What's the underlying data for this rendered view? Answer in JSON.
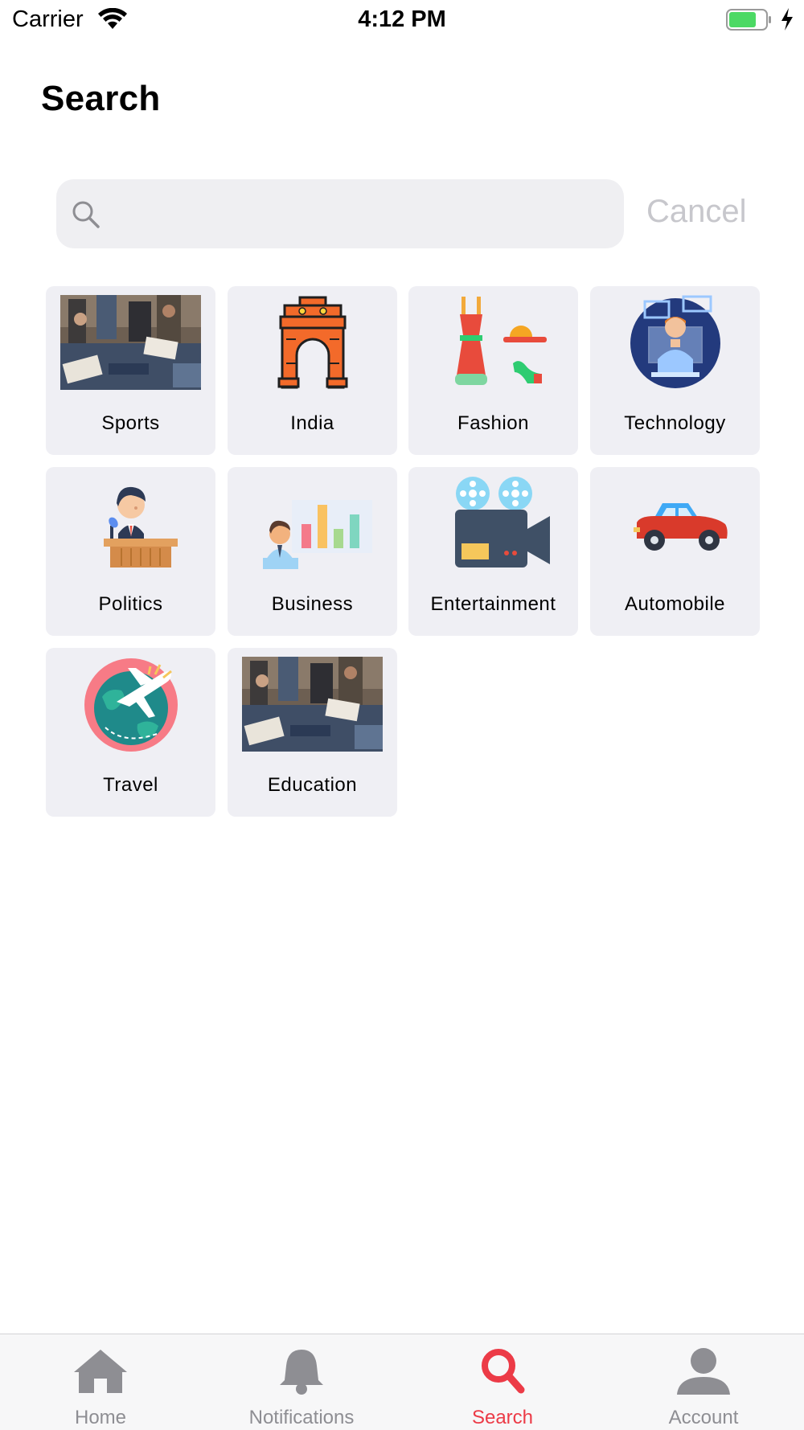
{
  "status_bar": {
    "carrier": "Carrier",
    "time": "4:12 PM",
    "battery_color": "#4cd964"
  },
  "header": {
    "title": "Search"
  },
  "search": {
    "value": "",
    "placeholder": "",
    "cancel_label": "Cancel"
  },
  "categories": [
    {
      "label": "Sports",
      "icon": "classroom-photo"
    },
    {
      "label": "India",
      "icon": "india-gate-icon"
    },
    {
      "label": "Fashion",
      "icon": "dress-hat-shoe-icon"
    },
    {
      "label": "Technology",
      "icon": "tech-person-icon"
    },
    {
      "label": "Politics",
      "icon": "speaker-podium-icon"
    },
    {
      "label": "Business",
      "icon": "business-chart-icon"
    },
    {
      "label": "Entertainment",
      "icon": "movie-camera-icon"
    },
    {
      "label": "Automobile",
      "icon": "car-icon"
    },
    {
      "label": "Travel",
      "icon": "globe-airplane-icon"
    },
    {
      "label": "Education",
      "icon": "classroom-photo"
    }
  ],
  "tab_bar": {
    "accent_color": "#ec3b47",
    "inactive_color": "#8e8e93",
    "tabs": [
      {
        "label": "Home",
        "icon": "home-icon"
      },
      {
        "label": "Notifications",
        "icon": "bell-icon"
      },
      {
        "label": "Search",
        "icon": "search-icon",
        "active": true
      },
      {
        "label": "Account",
        "icon": "person-icon"
      }
    ]
  }
}
